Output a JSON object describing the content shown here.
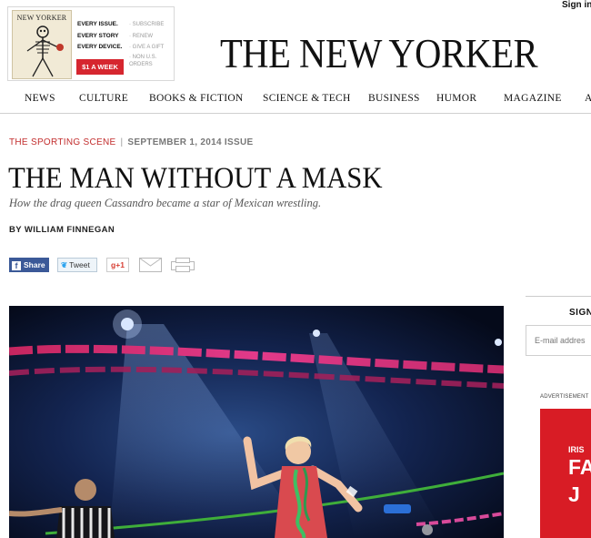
{
  "header": {
    "signin_label": "Sign in",
    "logo_text": "THE NEW YORKER"
  },
  "promo": {
    "cover_masthead": "NEW YORKER",
    "lines": [
      "EVERY ISSUE.",
      "EVERY STORY",
      "EVERY DEVICE."
    ],
    "cta_label": "$1 A WEEK",
    "links": [
      "· SUBSCRIBE",
      "· RENEW",
      "· GIVE A GIFT",
      "· NON U.S.",
      "ORDERS"
    ]
  },
  "nav": {
    "items": [
      "NEWS",
      "CULTURE",
      "BOOKS & FICTION",
      "SCIENCE & TECH",
      "BUSINESS",
      "HUMOR",
      "MAGAZINE",
      "A"
    ]
  },
  "article": {
    "section": "THE SPORTING SCENE",
    "separator": "|",
    "issue": "SEPTEMBER 1, 2014 ISSUE",
    "headline": "THE MAN WITHOUT A MASK",
    "dek": "How the drag queen Cassandro became a star of Mexican wrestling.",
    "byline": "BY WILLIAM FINNEGAN"
  },
  "share": {
    "facebook_label": "Share",
    "twitter_label": "Tweet",
    "gplus_label": "g+1"
  },
  "rail": {
    "signup_heading": "SIGN",
    "email_placeholder": "E-mail addres",
    "ad_label": "ADVERTISEMENT",
    "ad_lines": [
      "IRIS",
      "FA",
      "J"
    ]
  },
  "colors": {
    "accent_red": "#d6262f",
    "section_red": "#c22d2d",
    "facebook_blue": "#3b5998",
    "ad_red": "#d81c25"
  }
}
